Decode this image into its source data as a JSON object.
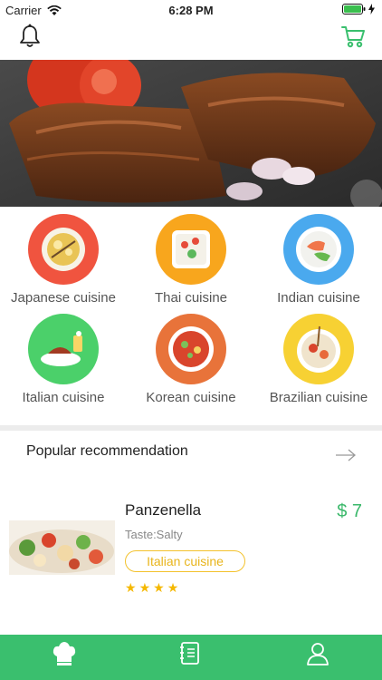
{
  "status_bar": {
    "carrier": "Carrier",
    "time": "6:28 PM"
  },
  "header": {
    "bell_icon": "bell-icon",
    "cart_icon": "cart-icon"
  },
  "banner": {
    "image_semantic": "grilled-steak-photo"
  },
  "cuisines": [
    {
      "label": "Japanese cuisine",
      "color": "#f0543f"
    },
    {
      "label": "Thai cuisine",
      "color": "#f8a61d"
    },
    {
      "label": "Indian cuisine",
      "color": "#4aa9ee"
    },
    {
      "label": "Italian cuisine",
      "color": "#4bd06a"
    },
    {
      "label": "Korean cuisine",
      "color": "#e8733a"
    },
    {
      "label": "Brazilian cuisine",
      "color": "#f7d133"
    }
  ],
  "section": {
    "title": "Popular recommendation"
  },
  "dish": {
    "name": "Panzenella",
    "price": "$ 7",
    "taste": "Taste:Salty",
    "tag": "Italian cuisine",
    "rating": 4
  },
  "tab_bar": {
    "tabs": [
      "chef-hat-icon",
      "menu-book-icon",
      "profile-icon"
    ]
  },
  "colors": {
    "accent": "#3abf6e",
    "price": "#3ab86a",
    "tag": "#f3c22d",
    "star": "#f5b800"
  }
}
